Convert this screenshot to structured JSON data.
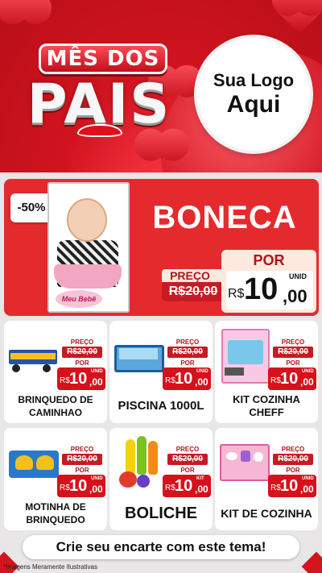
{
  "header": {
    "title_top": "MÊS DOS",
    "title_main": "PAIS",
    "logo_line1": "Sua Logo",
    "logo_line2": "Aqui"
  },
  "featured": {
    "discount": "-50%",
    "name": "BONECA",
    "box_label": "Meu Bebê",
    "preco_label": "PREÇO",
    "old_price": "R$20,00",
    "por_label": "POR",
    "currency": "R$",
    "price_int": "10",
    "price_dec": ",00",
    "unit": "UNID"
  },
  "products": [
    {
      "name": "BRINQUEDO DE CAMINHAO",
      "preco_label": "PREÇO",
      "old_price": "R$20,00",
      "por_label": "POR",
      "currency": "R$",
      "price_int": "10",
      "price_dec": ",00",
      "unit": "UNID"
    },
    {
      "name": "PISCINA 1000L",
      "preco_label": "PREÇO",
      "old_price": "R$20,00",
      "por_label": "POR",
      "currency": "R$",
      "price_int": "10",
      "price_dec": ",00",
      "unit": "UNID"
    },
    {
      "name": "KIT COZINHA CHEFF",
      "preco_label": "PREÇO",
      "old_price": "R$20,00",
      "por_label": "POR",
      "currency": "R$",
      "price_int": "10",
      "price_dec": ",00",
      "unit": "UNID"
    },
    {
      "name": "MOTINHA DE BRINQUEDO",
      "preco_label": "PREÇO",
      "old_price": "R$20,00",
      "por_label": "POR",
      "currency": "R$",
      "price_int": "10",
      "price_dec": ",00",
      "unit": "UNID"
    },
    {
      "name": "BOLICHE",
      "preco_label": "PREÇO",
      "old_price": "R$20,00",
      "por_label": "POR",
      "currency": "R$",
      "price_int": "10",
      "price_dec": ",00",
      "unit": "KIT"
    },
    {
      "name": "KIT DE COZINHA",
      "preco_label": "PREÇO",
      "old_price": "R$20,00",
      "por_label": "POR",
      "currency": "R$",
      "price_int": "10",
      "price_dec": ",00",
      "unit": "UNID"
    }
  ],
  "footer": {
    "cta": "Crie seu encarte com este tema!",
    "disclaimer": "*Imagens Meramente Ilustrativas"
  },
  "colors": {
    "brand_red": "#d8101b",
    "header_red": "#c20f1a",
    "featured_red": "#e52a2d",
    "cream": "#fde9dd",
    "background": "#e8e6e6"
  }
}
